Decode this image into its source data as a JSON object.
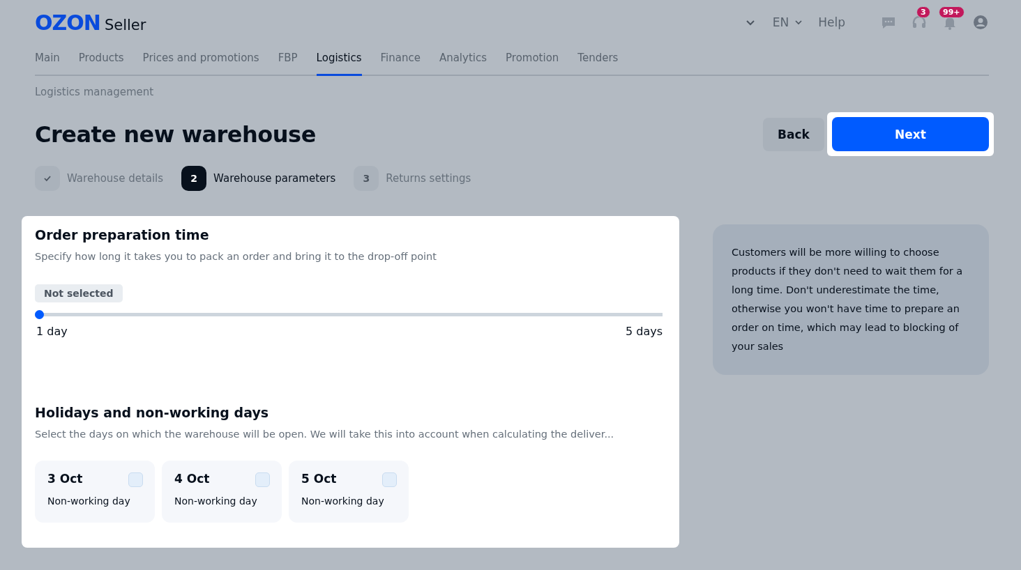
{
  "header": {
    "logo": "OZON",
    "logo_suffix": "Seller",
    "language": "EN",
    "help": "Help",
    "support_badge": "3",
    "notifications_badge": "99+"
  },
  "nav": [
    {
      "label": "Main",
      "selected": false
    },
    {
      "label": "Products",
      "selected": false
    },
    {
      "label": "Prices and promotions",
      "selected": false
    },
    {
      "label": "FBP",
      "selected": false
    },
    {
      "label": "Logistics",
      "selected": true
    },
    {
      "label": "Finance",
      "selected": false
    },
    {
      "label": "Analytics",
      "selected": false
    },
    {
      "label": "Promotion",
      "selected": false
    },
    {
      "label": "Tenders",
      "selected": false
    }
  ],
  "breadcrumb": "Logistics management",
  "title": "Create new warehouse",
  "buttons": {
    "back": "Back",
    "next": "Next"
  },
  "steps": [
    {
      "kind": "done",
      "label": "Warehouse details"
    },
    {
      "kind": "current",
      "number": "2",
      "label": "Warehouse parameters"
    },
    {
      "kind": "pending",
      "number": "3",
      "label": "Returns settings"
    }
  ],
  "preparation": {
    "title": "Order preparation time",
    "description": "Specify how long it takes you to pack an order and bring it to the drop-off point",
    "value_tag": "Not selected",
    "level": 0,
    "min_label": "1 day",
    "max_label": "5 days"
  },
  "holidays": {
    "title": "Holidays and non-working days",
    "description": "Select the days on which the warehouse will be open. We will take this into account when calculating the deliver...",
    "days": [
      {
        "date": "3 Oct",
        "note": "Non-working day",
        "checked": false
      },
      {
        "date": "4 Oct",
        "note": "Non-working day",
        "checked": false
      },
      {
        "date": "5 Oct",
        "note": "Non-working day",
        "checked": false
      }
    ]
  },
  "tip": "Customers will be more willing to choose products if they don't need to wait them for a long time. Don't underestimate the time, otherwise you won't have time to prepare an order on time, which may lead to blocking of your sales"
}
